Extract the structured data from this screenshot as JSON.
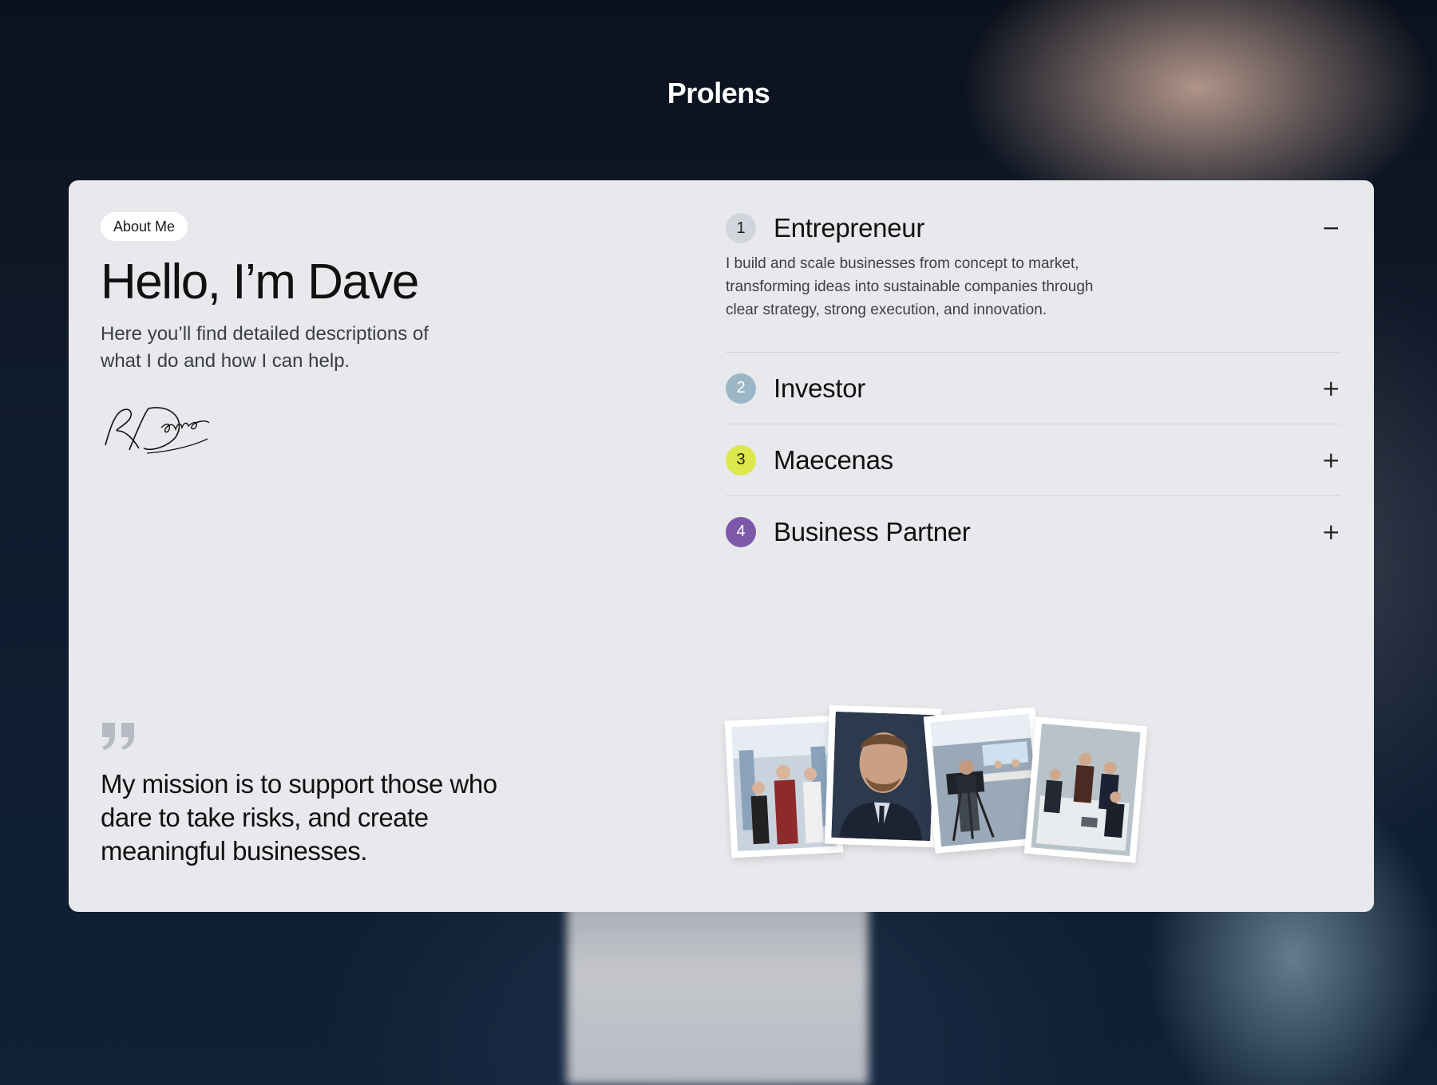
{
  "brand": "Prolens",
  "about": {
    "badge": "About Me",
    "heading": "Hello, I’m Dave",
    "intro": "Here you’ll find detailed descriptions of what I do and how I can help.",
    "signature": "RDave"
  },
  "mission": {
    "icon": "quote-icon",
    "text": "My mission is to support those who dare to take risks, and create meaningful businesses."
  },
  "roles": [
    {
      "number": "1",
      "title": "Entrepreneur",
      "expanded": true,
      "toggle": "−",
      "color": "#d2d5dc",
      "text_color": "#1b1b1b",
      "description": "I build and scale businesses from concept to market, transforming ideas into sustainable companies through clear strategy, strong execution, and innovation."
    },
    {
      "number": "2",
      "title": "Investor",
      "expanded": false,
      "toggle": "+",
      "color": "#9bb7c6",
      "text_color": "#ffffff"
    },
    {
      "number": "3",
      "title": "Maecenas",
      "expanded": false,
      "toggle": "+",
      "color": "#dde84c",
      "text_color": "#1b1b1b"
    },
    {
      "number": "4",
      "title": "Business Partner",
      "expanded": false,
      "toggle": "+",
      "color": "#7d58a8",
      "text_color": "#ffffff"
    }
  ],
  "photos": [
    {
      "name": "photo-team-meeting-office"
    },
    {
      "name": "photo-portrait-businessman"
    },
    {
      "name": "photo-tv-studio-camera"
    },
    {
      "name": "photo-team-at-table"
    }
  ]
}
